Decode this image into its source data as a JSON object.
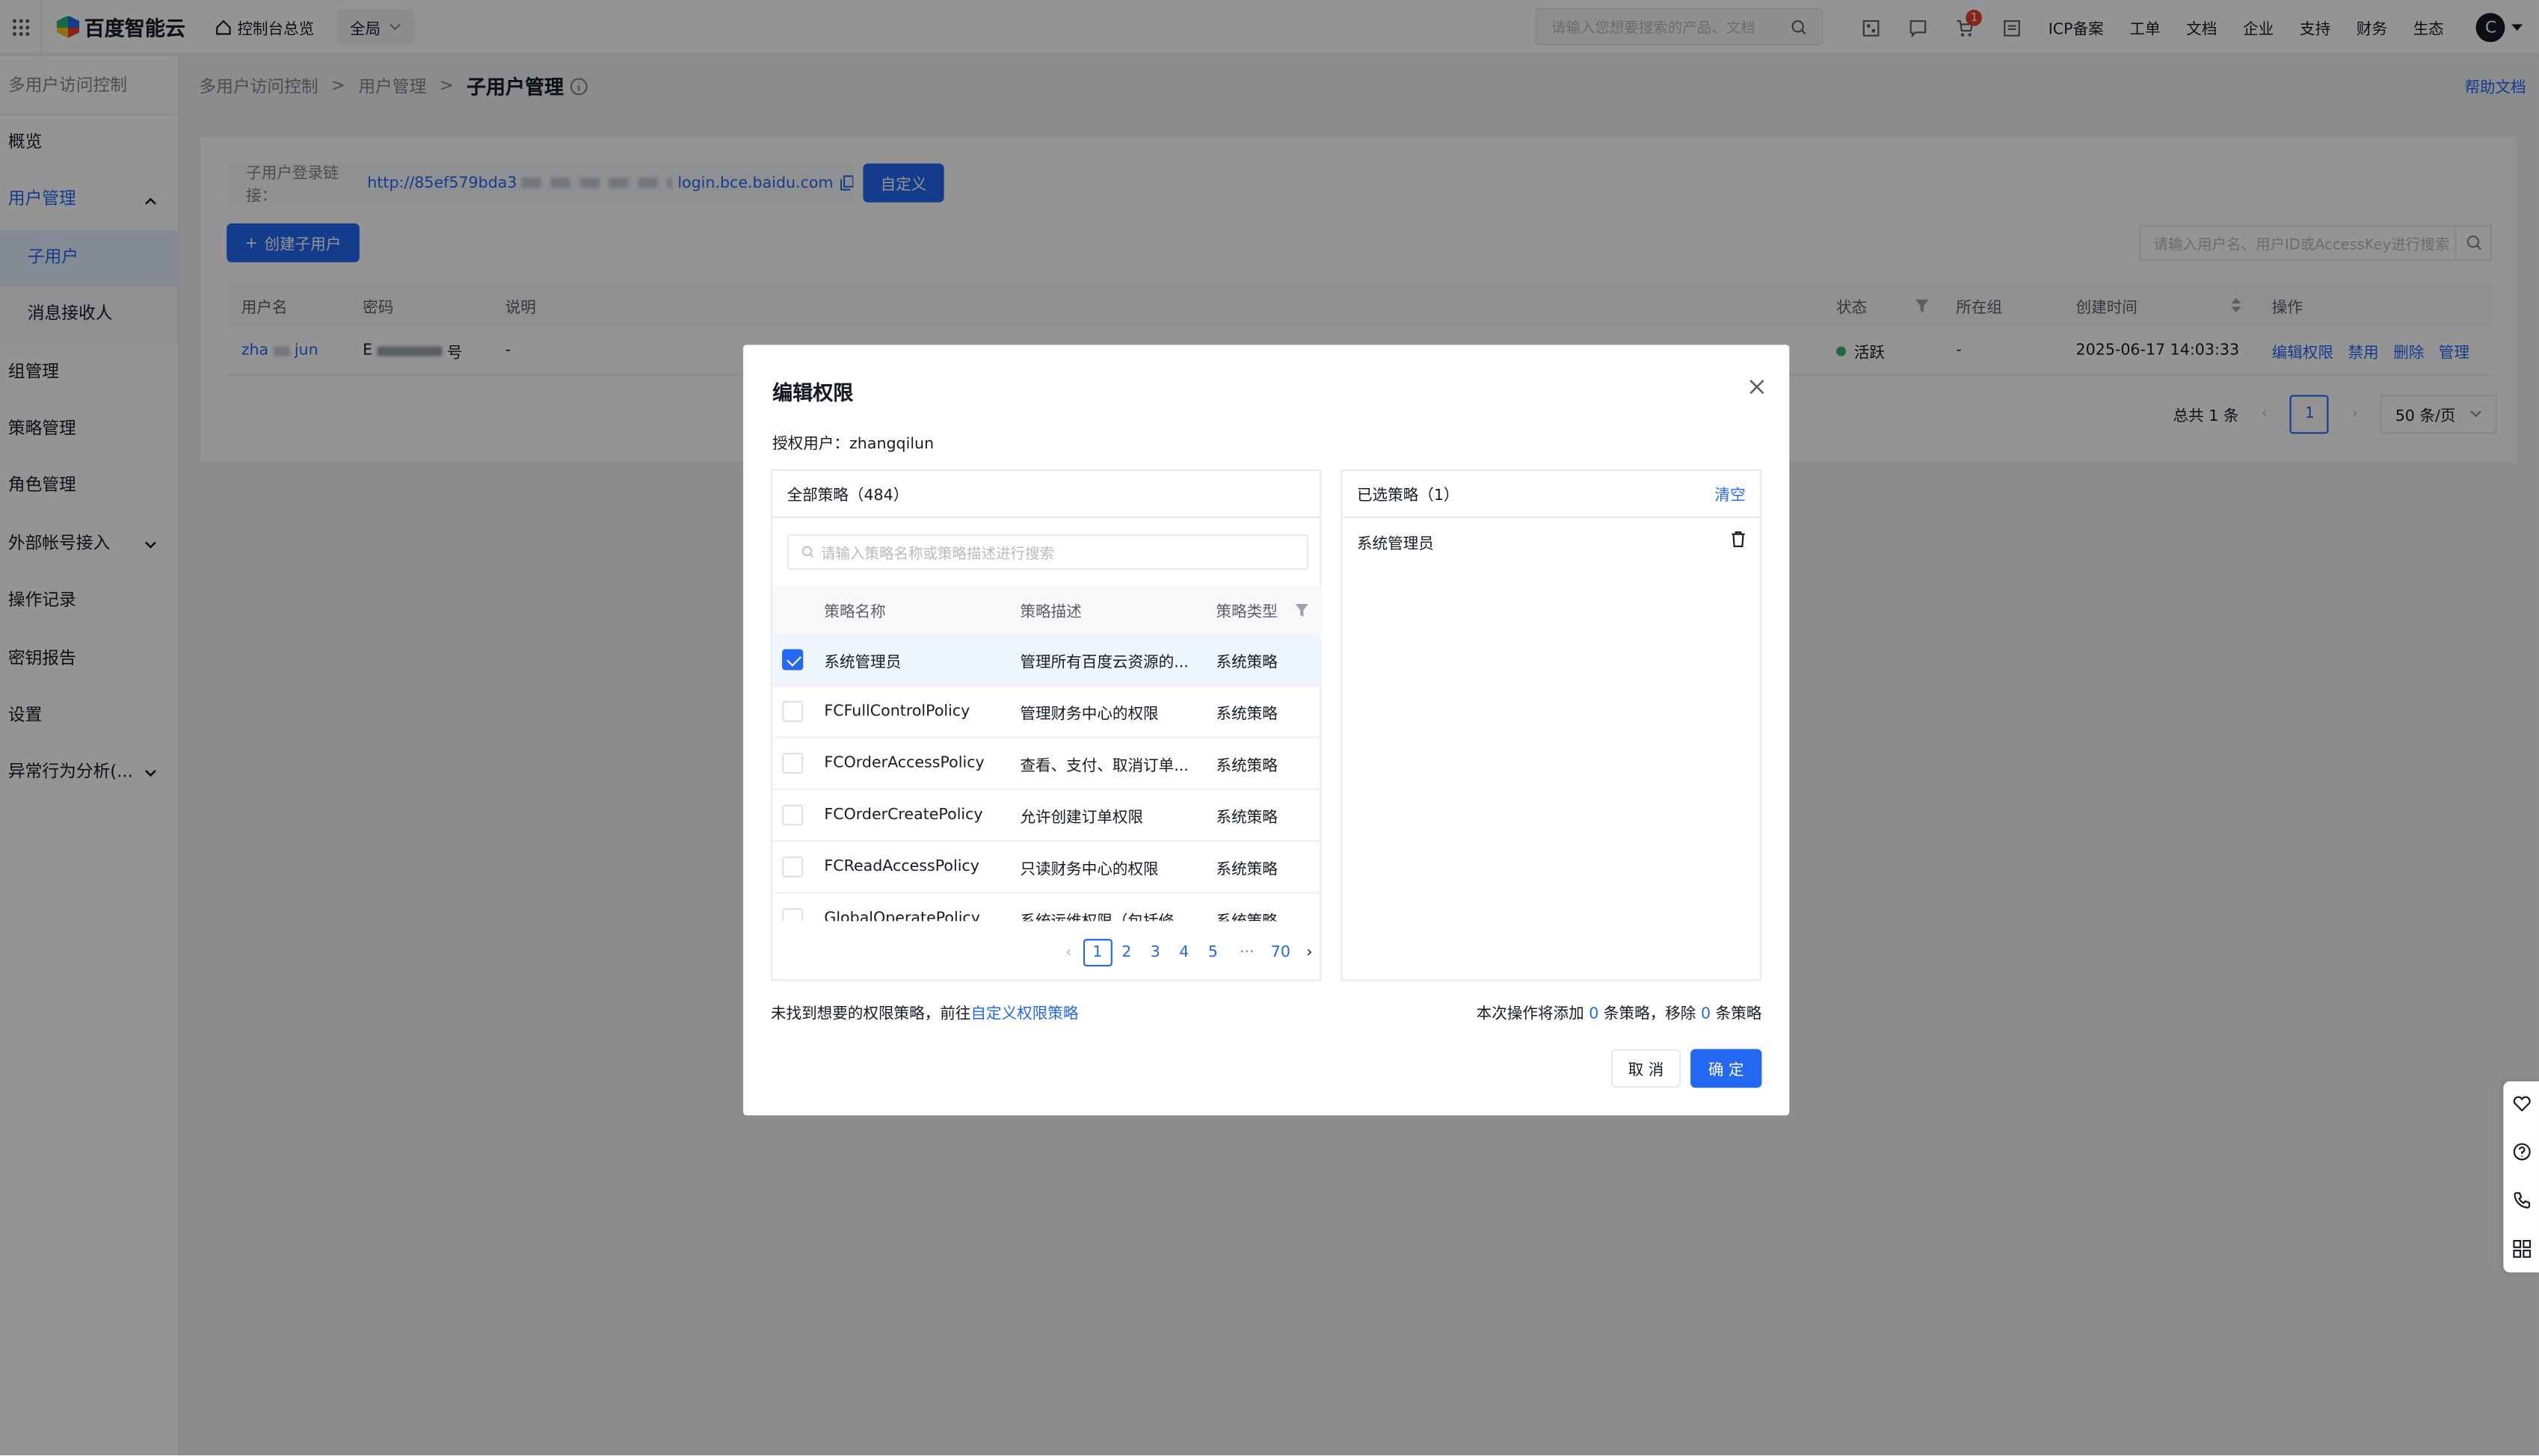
{
  "topbar": {
    "brand": "百度智能云",
    "console_home": "控制台总览",
    "scope": "全局",
    "search_placeholder": "请输入您想要搜索的产品、文档",
    "cart_badge": "1",
    "links": [
      "ICP备案",
      "工单",
      "文档",
      "企业",
      "支持",
      "财务",
      "生态"
    ],
    "avatar": "C"
  },
  "sidebar": {
    "title": "多用户访问控制",
    "items": [
      {
        "label": "概览"
      },
      {
        "label": "用户管理"
      },
      {
        "label": "子用户"
      },
      {
        "label": "消息接收人"
      },
      {
        "label": "组管理"
      },
      {
        "label": "策略管理"
      },
      {
        "label": "角色管理"
      },
      {
        "label": "外部帐号接入"
      },
      {
        "label": "操作记录"
      },
      {
        "label": "密钥报告"
      },
      {
        "label": "设置"
      },
      {
        "label": "异常行为分析(..."
      }
    ]
  },
  "breadcrumb": {
    "b1": "多用户访问控制",
    "b2": "用户管理",
    "current": "子用户管理",
    "help": "帮助文档"
  },
  "list": {
    "login_label": "子用户登录链接：",
    "login_url_start": "http://85ef579bda3",
    "login_url_end": "login.bce.baidu.com",
    "custom_button": "自定义",
    "create_button": "创建子用户",
    "search_placeholder": "请输入用户名、用户ID或AccessKey进行搜索",
    "columns": {
      "name": "用户名",
      "password": "密码",
      "desc": "说明",
      "status": "状态",
      "group": "所在组",
      "created": "创建时间",
      "ops": "操作"
    },
    "row": {
      "name_a": "zha",
      "name_b": "jun",
      "password_a": "E",
      "password_b": "号",
      "desc": "-",
      "status": "活跃",
      "group": "-",
      "created": "2025-06-17 14:03:33",
      "op1": "编辑权限",
      "op2": "禁用",
      "op3": "删除",
      "op4": "管理"
    },
    "total": "总共 1 条",
    "page": "1",
    "per_page": "50 条/页"
  },
  "modal": {
    "title": "编辑权限",
    "user_label": "授权用户：",
    "user": "zhangqilun",
    "left_title": "全部策略（484）",
    "search_placeholder": "请输入策略名称或策略描述进行搜索",
    "col_name": "策略名称",
    "col_desc": "策略描述",
    "col_type": "策略类型",
    "rows": [
      {
        "name": "系统管理员",
        "desc": "管理所有百度云资源的...",
        "type": "系统策略"
      },
      {
        "name": "FCFullControlPolicy",
        "desc": "管理财务中心的权限",
        "type": "系统策略"
      },
      {
        "name": "FCOrderAccessPolicy",
        "desc": "查看、支付、取消订单...",
        "type": "系统策略"
      },
      {
        "name": "FCOrderCreatePolicy",
        "desc": "允许创建订单权限",
        "type": "系统策略"
      },
      {
        "name": "FCReadAccessPolicy",
        "desc": "只读财务中心的权限",
        "type": "系统策略"
      },
      {
        "name": "GlobalOperatePolicy",
        "desc": "系统运维权限（包括修...",
        "type": "系统策略"
      }
    ],
    "pages": [
      "1",
      "2",
      "3",
      "4",
      "5",
      "···",
      "70"
    ],
    "right_title": "已选策略（1）",
    "clear": "清空",
    "selected": [
      "系统管理员"
    ],
    "foot_left_text": "未找到想要的权限策略，前往",
    "foot_left_link": "自定义权限策略",
    "foot_right_a": "本次操作将添加",
    "foot_right_add": "0",
    "foot_right_b": "条策略，移除",
    "foot_right_remove": "0",
    "foot_right_c": "条策略",
    "cancel": "取 消",
    "ok": "确 定"
  },
  "colors": {
    "accent": "#2468f2",
    "status_active": "#3cb371"
  }
}
